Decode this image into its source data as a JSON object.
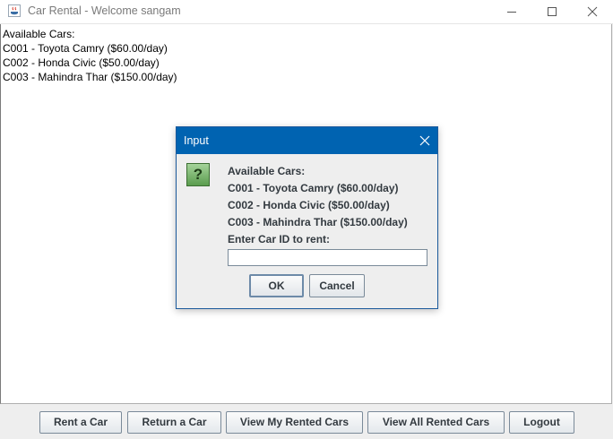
{
  "window": {
    "title": "Car Rental - Welcome sangam",
    "controls": [
      "minimize-icon",
      "maximize-icon",
      "close-icon"
    ]
  },
  "main": {
    "lines": [
      "Available Cars:",
      "C001 - Toyota Camry ($60.00/day)",
      "C002 - Honda Civic ($50.00/day)",
      "C003 - Mahindra Thar ($150.00/day)"
    ]
  },
  "toolbar": {
    "buttons": [
      "Rent a Car",
      "Return a Car",
      "View My Rented Cars",
      "View All Rented Cars",
      "Logout"
    ]
  },
  "dialog": {
    "title": "Input",
    "icon": "question-icon",
    "icon_glyph": "?",
    "message_lines": [
      "Available Cars:",
      "C001 - Toyota Camry ($60.00/day)",
      "C002 - Honda Civic ($50.00/day)",
      "C003 - Mahindra Thar ($150.00/day)",
      "Enter Car ID to rent:"
    ],
    "input_value": "",
    "ok_label": "OK",
    "cancel_label": "Cancel"
  },
  "colors": {
    "dialog_titlebar": "#0063b1",
    "question_icon": "#6aa85c"
  }
}
